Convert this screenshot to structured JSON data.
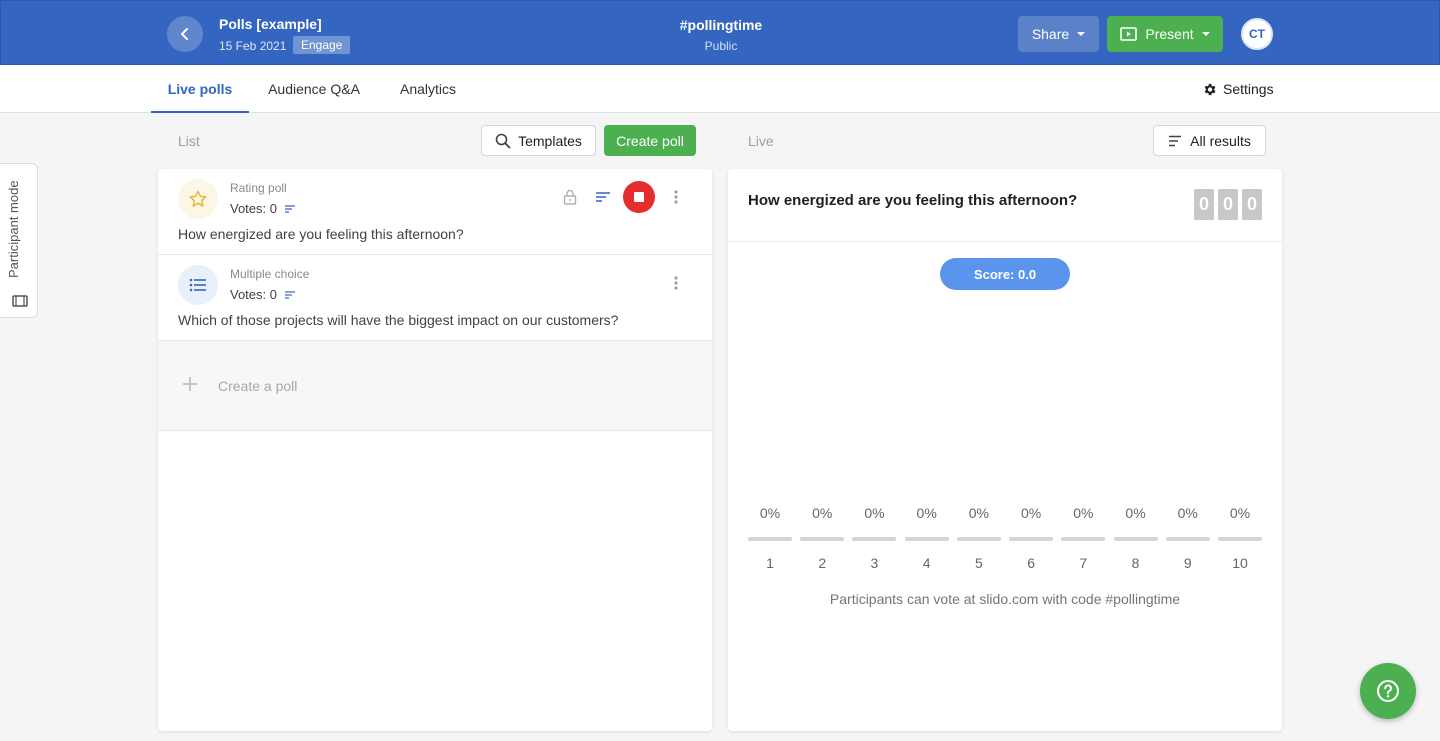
{
  "header": {
    "title": "Polls [example]",
    "date": "15 Feb 2021",
    "badge": "Engage",
    "event_code": "#pollingtime",
    "privacy": "Public",
    "share_label": "Share",
    "present_label": "Present",
    "avatar_initials": "CT"
  },
  "tabs": [
    {
      "label": "Live polls",
      "active": true
    },
    {
      "label": "Audience Q&A",
      "active": false
    },
    {
      "label": "Analytics",
      "active": false
    }
  ],
  "settings_label": "Settings",
  "participant_mode_label": "Participant mode",
  "list": {
    "label": "List",
    "templates_label": "Templates",
    "create_label": "Create poll",
    "polls": [
      {
        "type": "Rating poll",
        "votes": "Votes: 0",
        "question": "How energized are you feeling this afternoon?",
        "icon": "star-icon"
      },
      {
        "type": "Multiple choice",
        "votes": "Votes: 0",
        "question": "Which of those projects will have the biggest impact on our customers?",
        "icon": "list-icon"
      }
    ],
    "create_row_label": "Create a poll"
  },
  "live": {
    "label": "Live",
    "all_results_label": "All results",
    "question": "How energized are you feeling this afternoon?",
    "counter_digits": [
      "0",
      "0",
      "0"
    ],
    "score_label": "Score: 0.0",
    "note": "Participants can vote at slido.com with code #pollingtime"
  },
  "chart_data": {
    "type": "bar",
    "categories": [
      "1",
      "2",
      "3",
      "4",
      "5",
      "6",
      "7",
      "8",
      "9",
      "10"
    ],
    "values": [
      0,
      0,
      0,
      0,
      0,
      0,
      0,
      0,
      0,
      0
    ],
    "value_labels": [
      "0%",
      "0%",
      "0%",
      "0%",
      "0%",
      "0%",
      "0%",
      "0%",
      "0%",
      "0%"
    ],
    "ylim": [
      0,
      100
    ]
  },
  "colors": {
    "header_blue": "#3466c1",
    "green": "#4caf50",
    "stop_red": "#e52d2d",
    "score_blue": "#5b94ec"
  }
}
